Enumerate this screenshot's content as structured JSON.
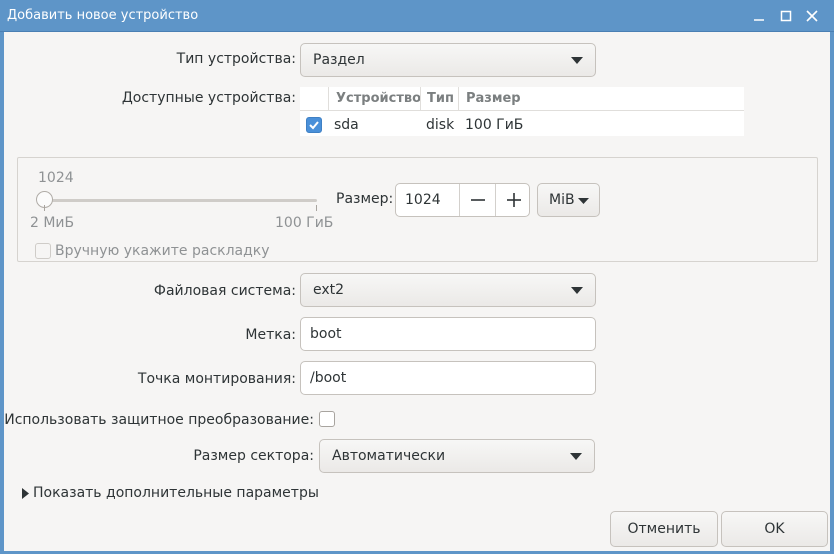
{
  "window": {
    "title": "Добавить новое устройство"
  },
  "device_type": {
    "label": "Тип устройства:",
    "value": "Раздел"
  },
  "available_devices": {
    "label": "Доступные устройства:",
    "columns": [
      "Устройство",
      "Тип",
      "Размер"
    ],
    "rows": [
      {
        "checked": true,
        "device": "sda",
        "type": "disk",
        "size": "100 ГиБ"
      }
    ]
  },
  "size": {
    "slider_value": "1024",
    "slider_min": "2 МиБ",
    "slider_max": "100 ГиБ",
    "label": "Размер:",
    "value": "1024",
    "unit": "MiB",
    "manual_layout_label": "Вручную укажите раскладку"
  },
  "filesystem": {
    "label": "Файловая система:",
    "value": "ext2"
  },
  "label_field": {
    "label": "Метка:",
    "value": "boot"
  },
  "mountpoint": {
    "label": "Точка монтирования:",
    "value": "/boot"
  },
  "encryption": {
    "label": "Использовать защитное преобразование:",
    "checked": false
  },
  "sector_size": {
    "label": "Размер сектора:",
    "value": "Автоматически"
  },
  "advanced": {
    "label": "Показать дополнительные параметры"
  },
  "buttons": {
    "cancel": "Отменить",
    "ok": "OK"
  }
}
